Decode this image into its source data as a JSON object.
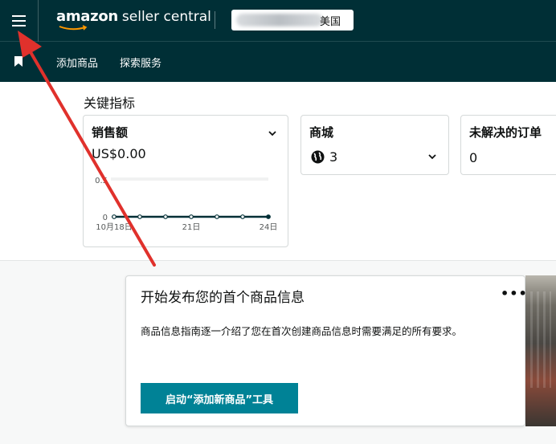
{
  "header": {
    "logo_brand": "amazon",
    "logo_rest": "seller central",
    "marketplace_country": "美国"
  },
  "subnav": {
    "items": [
      {
        "label": "添加商品"
      },
      {
        "label": "探索服务"
      }
    ]
  },
  "metrics": {
    "title": "关键指标",
    "sales": {
      "title": "销售额",
      "value": "US$0.00",
      "y_ticks": [
        "0.5",
        "0"
      ],
      "x_ticks": [
        "10月18日",
        "21日",
        "24日"
      ]
    },
    "marketplace": {
      "title": "商城",
      "count": "3"
    },
    "orders": {
      "title": "未解决的订单",
      "value": "0"
    }
  },
  "chart_data": {
    "type": "line",
    "x": [
      "10月18日",
      "10月19日",
      "10月20日",
      "10月21日",
      "10月22日",
      "10月23日",
      "10月24日"
    ],
    "values": [
      0,
      0,
      0,
      0,
      0,
      0,
      0
    ],
    "x_tick_labels": [
      "10月18日",
      "21日",
      "24日"
    ],
    "y_tick_labels": [
      "0",
      "0.5"
    ],
    "ylim": [
      0,
      1
    ],
    "grid": true
  },
  "listing_card": {
    "title": "开始发布您的首个商品信息",
    "more": "•••",
    "description": "商品信息指南逐一介绍了您在首次创建商品信息时需要满足的所有要求。",
    "button_label": "启动“添加新商品”工具"
  },
  "colors": {
    "header_bg": "#002f36",
    "accent": "#008296",
    "annotation_arrow": "#e0312c"
  }
}
